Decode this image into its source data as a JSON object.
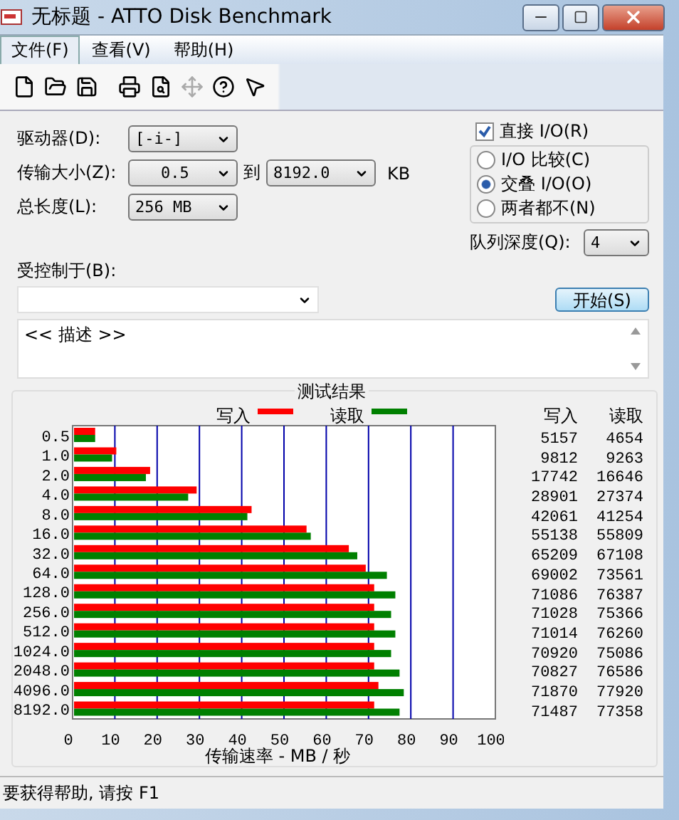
{
  "window": {
    "title": "无标题 - ATTO Disk Benchmark"
  },
  "menu": [
    {
      "label": "文件(F)",
      "selected": true
    },
    {
      "label": "查看(V)",
      "selected": false
    },
    {
      "label": "帮助(H)",
      "selected": false
    }
  ],
  "toolbar": [
    {
      "kind": "new",
      "disabled": false
    },
    {
      "kind": "open",
      "disabled": false
    },
    {
      "kind": "save",
      "disabled": false
    },
    {
      "kind": "print",
      "disabled": false
    },
    {
      "kind": "preview",
      "disabled": false
    },
    {
      "kind": "move",
      "disabled": true
    },
    {
      "kind": "help",
      "disabled": false
    },
    {
      "kind": "context_help",
      "disabled": false
    }
  ],
  "drive": {
    "label": "驱动器(D):",
    "value": "[-i-]"
  },
  "transfer_size": {
    "label": "传输大小(Z):",
    "from": "0.5",
    "to_label": "到",
    "to": "8192.0",
    "unit": "KB"
  },
  "total_length": {
    "label": "总长度(L):",
    "value": "256 MB"
  },
  "direct_io": {
    "label": "直接 I/O(R)",
    "checked": true
  },
  "io_mode": [
    {
      "label": "I/O 比较(C)",
      "selected": false
    },
    {
      "label": "交叠 I/O(O)",
      "selected": true
    },
    {
      "label": "两者都不(N)",
      "selected": false
    }
  ],
  "queue_depth": {
    "label": "队列深度(Q):",
    "value": "4"
  },
  "controlled_by": {
    "label": "受控制于(B):"
  },
  "start_button": "开始(S)",
  "description": "<< 描述 >>",
  "results": {
    "title": "测试结果",
    "chart_data": {
      "type": "bar",
      "orientation": "horizontal",
      "xlabel": "传输速率 - MB / 秒",
      "categories": [
        "0.5",
        "1.0",
        "2.0",
        "4.0",
        "8.0",
        "16.0",
        "32.0",
        "64.0",
        "128.0",
        "256.0",
        "512.0",
        "1024.0",
        "2048.0",
        "4096.0",
        "8192.0"
      ],
      "series": [
        {
          "name": "写入",
          "color": "#ff0000",
          "values": [
            5,
            10,
            18,
            29,
            42,
            55,
            65,
            69,
            71,
            71,
            71,
            71,
            71,
            72,
            71
          ]
        },
        {
          "name": "读取",
          "color": "#008000",
          "values": [
            5,
            9,
            17,
            27,
            41,
            56,
            67,
            74,
            76,
            75,
            76,
            75,
            77,
            78,
            77
          ]
        }
      ],
      "grid": true,
      "legend": true,
      "xlim": [
        0,
        100
      ],
      "xticks": [
        0,
        10,
        20,
        30,
        40,
        50,
        60,
        70,
        80,
        90,
        100
      ]
    },
    "columns": [
      "写入",
      "读取"
    ],
    "rows": [
      [
        "5157",
        "4654"
      ],
      [
        "9812",
        "9263"
      ],
      [
        "17742",
        "16646"
      ],
      [
        "28901",
        "27374"
      ],
      [
        "42061",
        "41254"
      ],
      [
        "55138",
        "55809"
      ],
      [
        "65209",
        "67108"
      ],
      [
        "69002",
        "73561"
      ],
      [
        "71086",
        "76387"
      ],
      [
        "71028",
        "75366"
      ],
      [
        "71014",
        "76260"
      ],
      [
        "70920",
        "75086"
      ],
      [
        "70827",
        "76586"
      ],
      [
        "71870",
        "77920"
      ],
      [
        "71487",
        "77358"
      ]
    ]
  },
  "status_bar": "要获得帮助, 请按 F1"
}
